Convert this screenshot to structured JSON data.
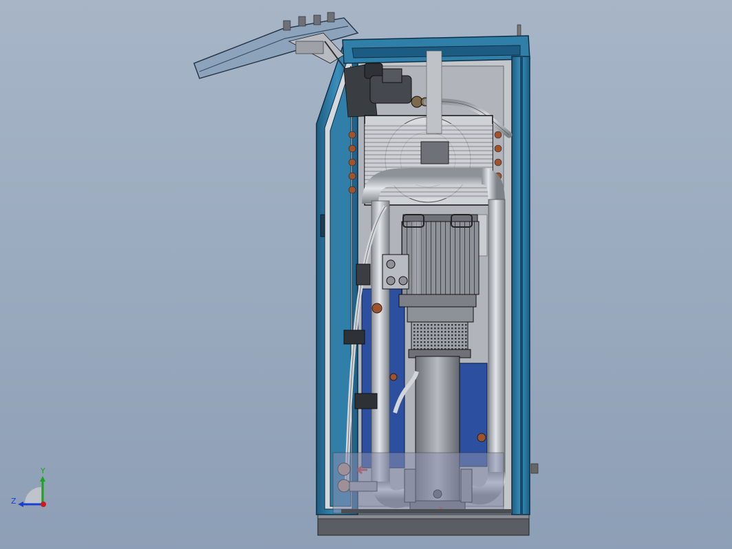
{
  "view": {
    "background_top": "#a7b5c7",
    "background_bottom": "#8d9fb6"
  },
  "colors": {
    "cabinet_blue": "#2f7fa8",
    "cabinet_dark": "#1f5f86",
    "pipe_steel": "#b8bcc2",
    "tank_blue": "#2c4fa0",
    "motor_grey": "#9a9da3",
    "base_dark": "#4a4d52",
    "accent_red": "#c0392b"
  },
  "triad": {
    "y_label": "Y",
    "z_label": "Z",
    "y_color": "#1aa51a",
    "z_color": "#1a3fd0",
    "origin_color": "#d01a1a"
  }
}
